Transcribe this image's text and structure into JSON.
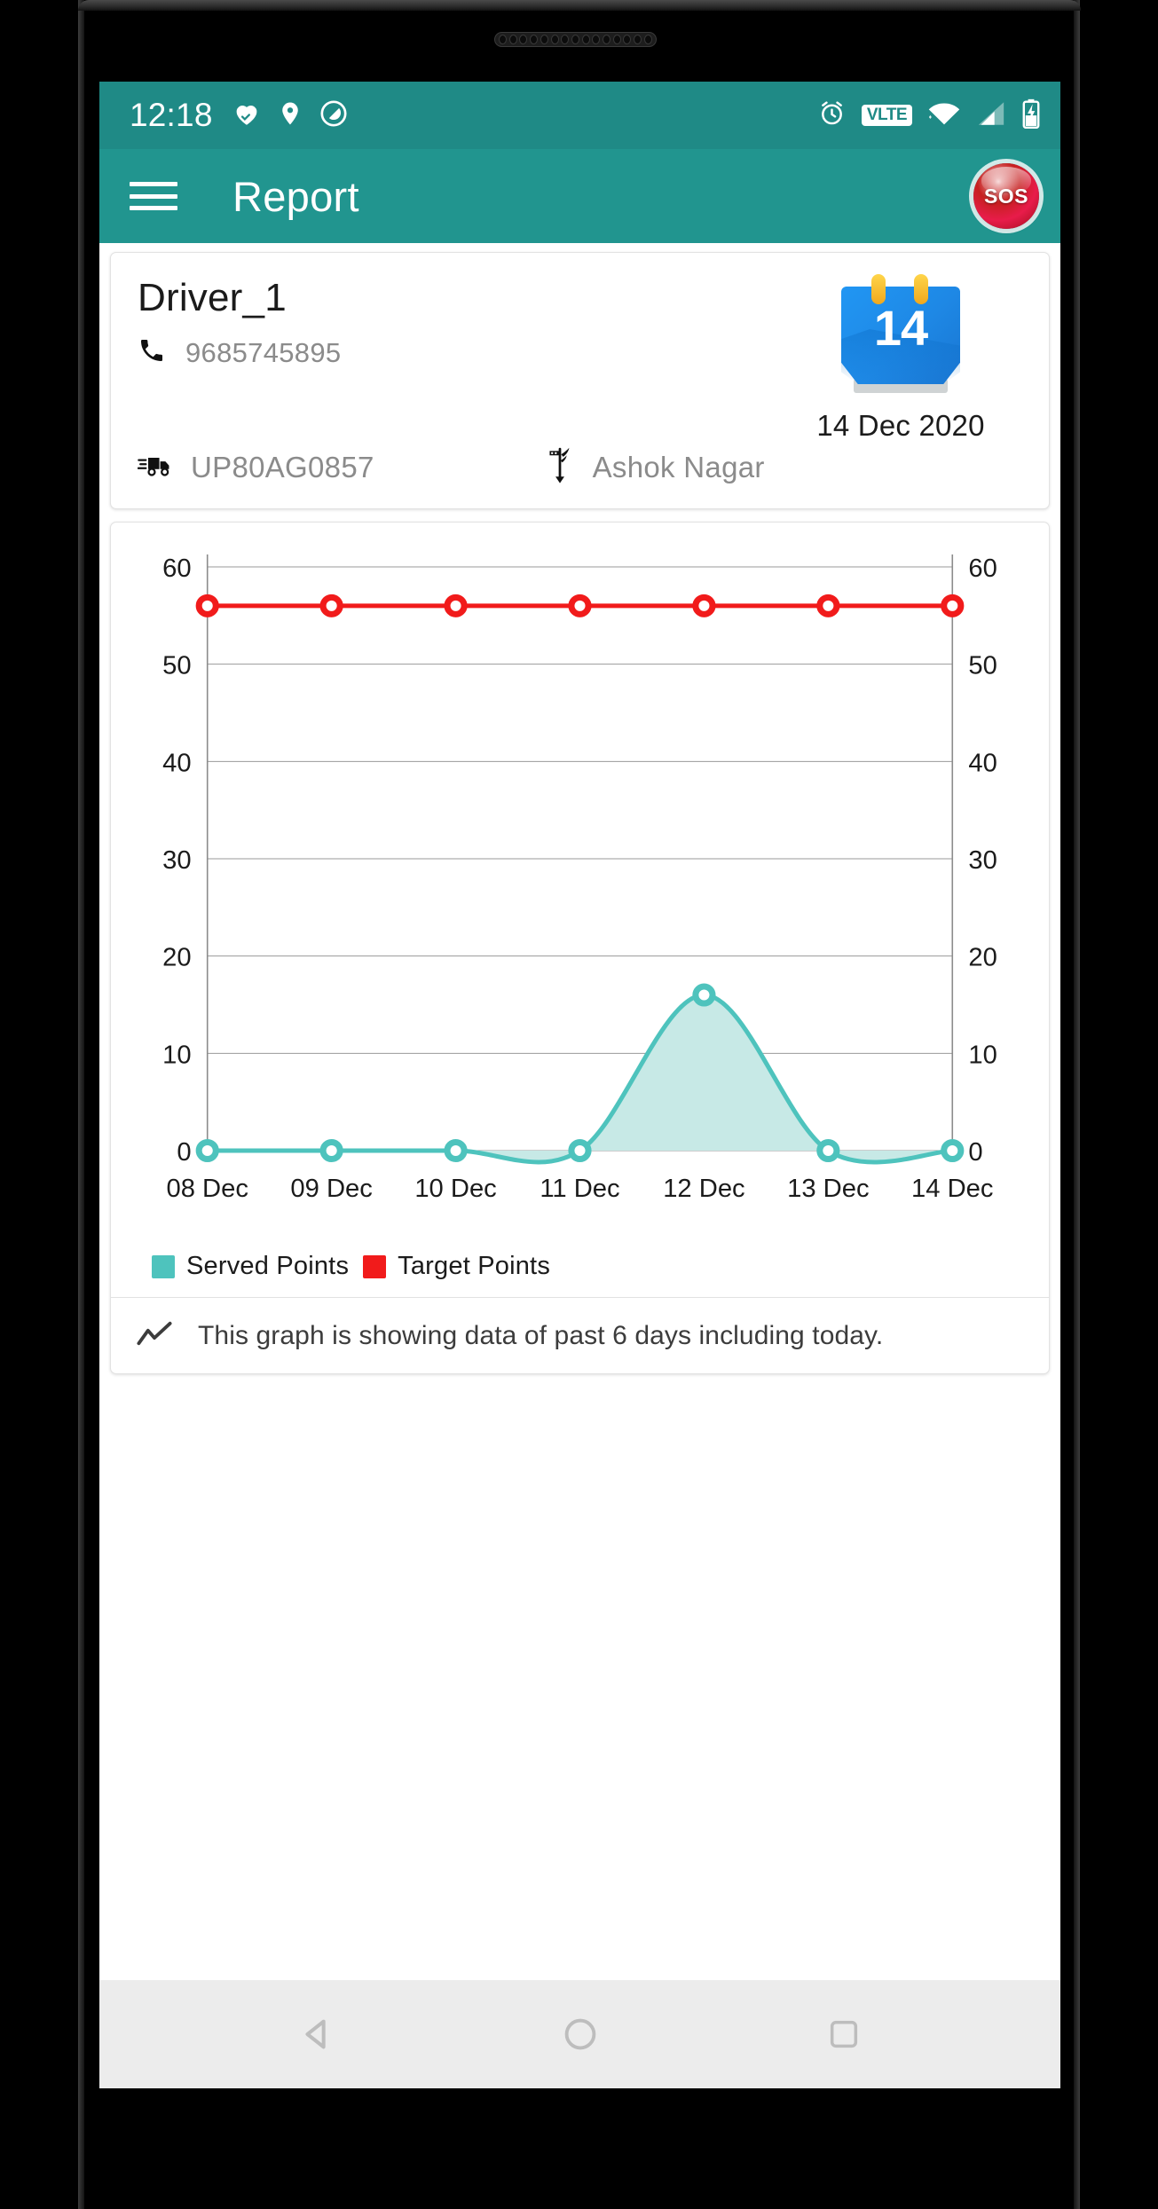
{
  "status_bar": {
    "time": "12:18",
    "left_icons": [
      "heart-pulse-icon",
      "location-pin-icon",
      "privacy-shield-icon"
    ],
    "right_icons": [
      "alarm-clock-icon",
      "volte-icon",
      "wifi-icon",
      "cellular-signal-icon",
      "battery-charging-icon"
    ],
    "volte_label": "V⁠LTE",
    "background": "#1f8a86"
  },
  "app_bar": {
    "title": "Report",
    "menu_icon": "hamburger-menu-icon",
    "sos_label": "SOS",
    "background": "#21958f"
  },
  "driver_card": {
    "name": "Driver_1",
    "phone": "9685745895",
    "phone_icon": "phone-icon",
    "calendar_day": "14",
    "calendar_date": "14 Dec 2020",
    "vehicle_number": "UP80AG0857",
    "vehicle_icon": "truck-icon",
    "location": "Ashok Nagar",
    "location_icon": "signpost-icon"
  },
  "chart_card": {
    "legend": [
      {
        "label": "Served Points",
        "color": "#4ec3bd"
      },
      {
        "label": "Target Points",
        "color": "#f11b1b"
      }
    ],
    "footer_icon": "trend-line-icon",
    "footer_text": "This graph is showing data of past 6 days including today."
  },
  "chart_data": {
    "type": "line",
    "title": "",
    "xlabel": "",
    "ylabel": "",
    "categories": [
      "08 Dec",
      "09 Dec",
      "10 Dec",
      "11 Dec",
      "12 Dec",
      "13 Dec",
      "14 Dec"
    ],
    "series": [
      {
        "name": "Served Points",
        "color": "#4ec3bd",
        "fill": "#c7e9e6",
        "values": [
          0,
          0,
          0,
          0,
          16,
          0,
          0
        ]
      },
      {
        "name": "Target Points",
        "color": "#f11b1b",
        "fill": "none",
        "values": [
          56,
          56,
          56,
          56,
          56,
          56,
          56
        ]
      }
    ],
    "ylim": [
      0,
      60
    ],
    "yticks": [
      0,
      10,
      20,
      30,
      40,
      50,
      60
    ],
    "y_axis_left_labels": [
      "0",
      "10",
      "20",
      "30",
      "40",
      "50",
      "60"
    ],
    "y_axis_right_labels": [
      "0",
      "10",
      "20",
      "30",
      "40",
      "50",
      "60"
    ],
    "grid": true,
    "legend_position": "bottom-left",
    "dual_axis": true,
    "smooth": true,
    "markers": true
  },
  "nav_bar": {
    "back_icon": "back-triangle-icon",
    "home_icon": "home-circle-icon",
    "recents_icon": "recents-square-icon"
  }
}
